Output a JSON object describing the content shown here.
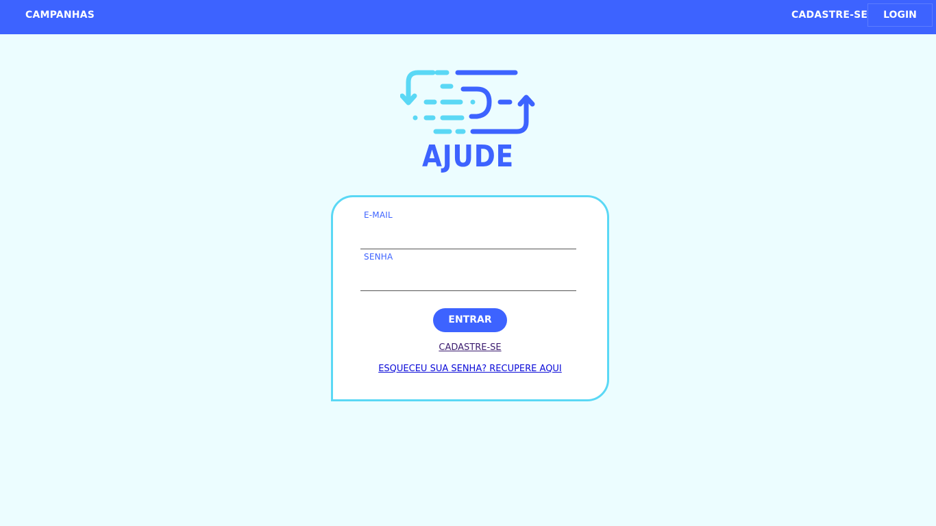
{
  "navbar": {
    "campanhas": "CAMPANHAS",
    "cadastre": "CADASTRE-SE",
    "login": "LOGIN"
  },
  "logo": {
    "text": "AJUDE",
    "colors": {
      "primary": "#3d63ff",
      "secondary": "#5ad8f5"
    }
  },
  "form": {
    "email_label": "E-MAIL",
    "email_value": "",
    "senha_label": "SENHA",
    "senha_value": "",
    "submit_label": "ENTRAR",
    "cadastre_link": "CADASTRE-SE",
    "recover_link": "ESQUECEU SUA SENHA? RECUPERE AQUI"
  },
  "colors": {
    "brand": "#3d63ff",
    "accent": "#5ad8f5",
    "background": "#ecfdff"
  }
}
